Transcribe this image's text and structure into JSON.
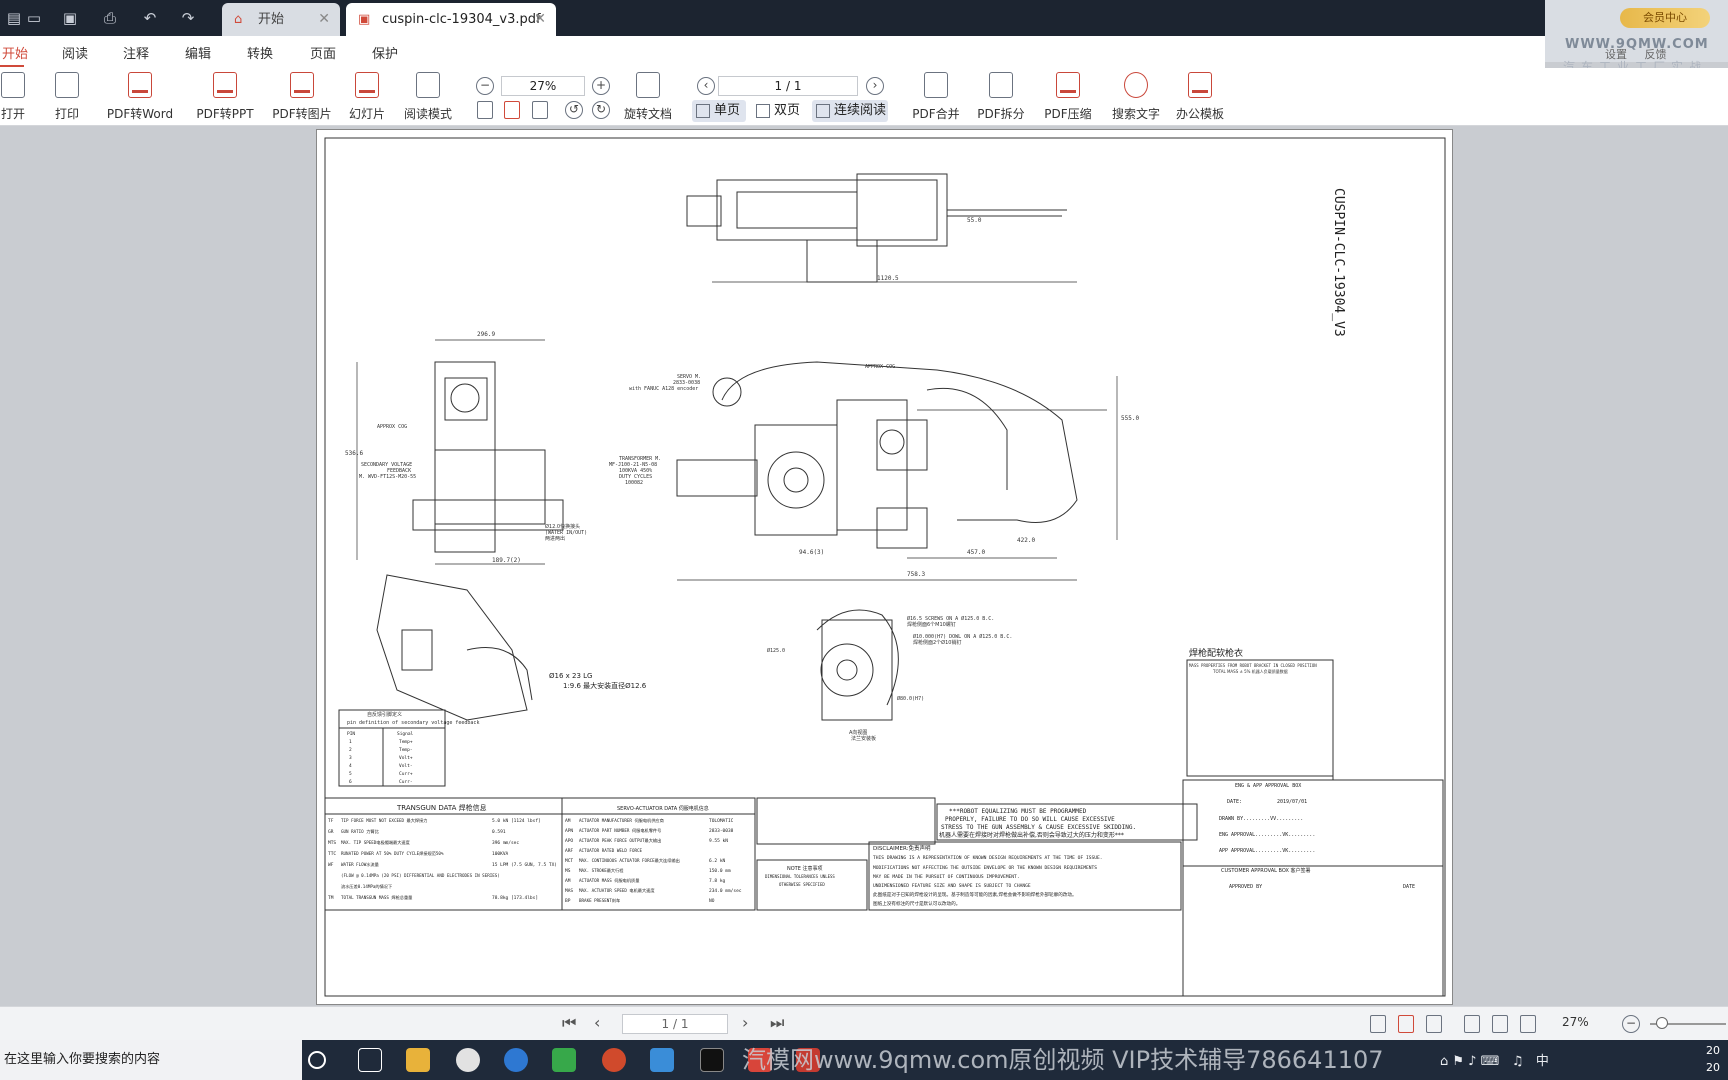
{
  "tabs": [
    {
      "label": "开始"
    },
    {
      "label": "cuspin-clc-19304_v3.pdf"
    }
  ],
  "vip": {
    "button": "会员中心",
    "settings": "设置",
    "feedback": "反馈",
    "watermark": "WWW.9QMW.COM",
    "watermark_sub": "汽车工业工厂实战"
  },
  "menu": [
    {
      "label": "开始"
    },
    {
      "label": "阅读"
    },
    {
      "label": "注释"
    },
    {
      "label": "编辑"
    },
    {
      "label": "转换"
    },
    {
      "label": "页面"
    },
    {
      "label": "保护"
    }
  ],
  "ribbon": {
    "open": "打开",
    "print": "打印",
    "to_word": "PDF转Word",
    "to_ppt": "PDF转PPT",
    "to_image": "PDF转图片",
    "slideshow": "幻灯片",
    "read_mode": "阅读模式",
    "zoom": "27%",
    "page": "1 / 1",
    "rotate": "旋转文档",
    "single": "单页",
    "double": "双页",
    "continuous": "连续阅读",
    "merge": "PDF合并",
    "split": "PDF拆分",
    "compress": "PDF压缩",
    "search_text": "搜索文字",
    "office_template": "办公模板"
  },
  "drawing": {
    "title_vertical": "CUSPIN-CLC-19304_V3",
    "dim_top_width": "1120.5",
    "dim_top_small": "55.0",
    "dim_side_width": "296.9",
    "dim_side_height": "536.6",
    "dim_side_bottom": "189.7(2)",
    "dim_main_height": "555.0",
    "dim_main_bottom1": "758.3",
    "dim_main_bottom2": "457.0",
    "dim_main_bottom3": "422.0",
    "dim_main_94": "94.6(3)",
    "approx_cog": "APPROX COG",
    "servo": "SERVO M.",
    "servo_code": "2833-0038",
    "servo_encoder": "with FANUC A128 encoder",
    "transformer": "TRANSFORMER M.",
    "transformer_code": "MF-J100-21-N5-08",
    "transformer_power": "100KVA 450%",
    "duty_cycles": "DUTY CYCLES",
    "duty_code": "100082",
    "secondary_voltage": "SECONDARY VOLTAGE",
    "feedback": "FEEDBACK",
    "feedback_code": "M. WVD-FT12S-M20-55",
    "water": "Ø12.0快换接头",
    "water2": "(WATER IN/OUT)",
    "water3": "两进两出",
    "cable_note1": "Ø16 x 23 LG",
    "cable_note2": "1:9.6 最大安装直径Ø12.6",
    "screws_note": "Ø16.5 SCREWS ON A Ø125.0 B.C.",
    "screws_cn": "焊枪侧面6个M10螺钉",
    "dowel_note": "Ø10.000(H7) DOWL ON A Ø125.0 B.C.",
    "dowel_cn": "焊枪侧面2个Ø10销钉",
    "d125": "Ø125.0",
    "d80": "Ø80.0(H7)",
    "view_a": "A向视图",
    "view_a2": "法兰安装板",
    "weld_cover": "焊枪配软枪衣",
    "mass_title": "MASS PROPERTIES FROM ROBOT BRACKET IN CLOSED POSITION",
    "mass_sub": "TOTAL MASS ± 5% 机器人负载质量数据",
    "pin_title": "自反馈引脚定义",
    "pin_sub": "pin definition of secondary voltage feedback",
    "pin_header": [
      "PIN",
      "Signal"
    ],
    "pin_rows": [
      [
        "1",
        "Temp+"
      ],
      [
        "2",
        "Temp-"
      ],
      [
        "3",
        "Volt+"
      ],
      [
        "4",
        "Volt-"
      ],
      [
        "5",
        "Curr+"
      ],
      [
        "6",
        "Curr-"
      ]
    ],
    "transgun_title": "TRANSGUN DATA 焊枪信息",
    "servo_title": "SERVO-ACTUATOR DATA 伺服电机信息",
    "transgun_rows": [
      [
        "TF",
        "TIP FORCE MUST NOT EXCEED 最大焊接力",
        "5.0 kN [1124 lbsf]"
      ],
      [
        "GR",
        "GUN RATIO 力臂比",
        "0.591"
      ],
      [
        "MTS",
        "MAX. TIP SPEED电极帽端最大速度",
        "396 mm/sec"
      ],
      [
        "TTC",
        "RUNATED POWER AT 50% DUTY CYCLE焊接规范50%",
        "100KVA"
      ],
      [
        "WF",
        "WATER FLOW水流量",
        "15 LPM (7.5 GUN, 7.5 TX)"
      ],
      [
        "",
        "(FLOW @ 0.14MPa (20 PSI) DIFFERENTIAL AND ELECTRODES IN SERIES)",
        ""
      ],
      [
        "",
        "流水压差0.14MPa的情况下",
        ""
      ],
      [
        "TM",
        "TOTAL TRANSGUN MASS 焊枪总重量",
        "78.8kg [173.4lbs]"
      ]
    ],
    "servo_rows": [
      [
        "AM",
        "ACTUATOR MANUFACTURER 伺服电机供应商",
        "TOLOMATIC"
      ],
      [
        "APN",
        "ACTUATOR PART NUMBER 伺服电机零件号",
        "2833-0038"
      ],
      [
        "APO",
        "ACTUATOR PEAK FORCE OUTPUT最大输出",
        "9.55 kN"
      ],
      [
        "ARF",
        "ACTUATOR RATED WELD FORCE",
        ""
      ],
      [
        "MCT",
        "MAX. CONTINUOUS ACTUATOR FORCE最大连续输出",
        "6.2 kN"
      ],
      [
        "MS",
        "MAX. STROKE最大行程",
        "150.0 mm"
      ],
      [
        "AM",
        "ACTUATOR MASS 伺服电机质量",
        "7.8 kg"
      ],
      [
        "MAS",
        "MAX. ACTUATOR SPEED 电机最大速度",
        "234.0 mm/sec"
      ],
      [
        "BP",
        "BRAKE PRESENT刹车",
        "NO"
      ]
    ],
    "robot_note": "***ROBOT EQUALIZING MUST BE PROGRAMMED",
    "robot_note2": "PROPERLY, FAILURE TO DO SO WILL CAUSE EXCESSIVE",
    "robot_note3": "STRESS TO THE GUN ASSEMBLY & CAUSE EXCESSIVE SKIDDING.",
    "robot_note_cn": "机器人需要在焊接时对焊枪做出补偿,否则会导致过大的压力和变形***",
    "disclaimer_title": "DISCLAIMER:免责声明",
    "disclaimer1": "THIS DRAWING IS A REPRESENTATION OF KNOWN DESIGN REQUIREMENTS AT THE TIME OF ISSUE.",
    "disclaimer2": "MODIFICATIONS NOT AFFECTING THE OUTSIDE ENVELOPE OR THE KNOWN DESIGN REQUIREMENTS",
    "disclaimer3": "MAY BE MADE IN THE PURSUIT OF CONTINUOUS IMPROVEMENT.",
    "disclaimer4": "UNDIMENSIONED FEATURE SIZE AND SHAPE IS SUBJECT TO CHANGE",
    "disclaimer5": "此图纸是对于已知的焊枪设计的呈现。基于制造等可能的因素,焊枪会做不影响焊枪外部轮廓的改动。",
    "disclaimer6": "图纸上没有标注的尺寸是默认可以改动的。",
    "note_title": "NOTE 注意事项",
    "note1": "DIMENSIONAL TOLERANCES UNLESS",
    "note2": "OTHERWISE SPECIFIED",
    "eng_title": "ENG & APP APPROVAL BOX",
    "date_label": "DATE:",
    "date": "2019/07/01",
    "drawn_by": "DRAWN BY.........VV.........",
    "eng_approval": "ENG APPROVAL.........VK.........",
    "app_approval": "APP APPROVAL.........VK.........",
    "customer_box": "CUSTOMER APPROVAL BOX 客户签署",
    "approved_by": "APPROVED BY",
    "date2": "DATE"
  },
  "bottom": {
    "page": "1 / 1",
    "zoom": "27%"
  },
  "taskbar": {
    "search": "在这里输入你要搜索的内容",
    "watermark": "汽模网www.9qmw.com原创视频 VIP技术辅导786641107",
    "ime": "中",
    "clock": "20"
  }
}
